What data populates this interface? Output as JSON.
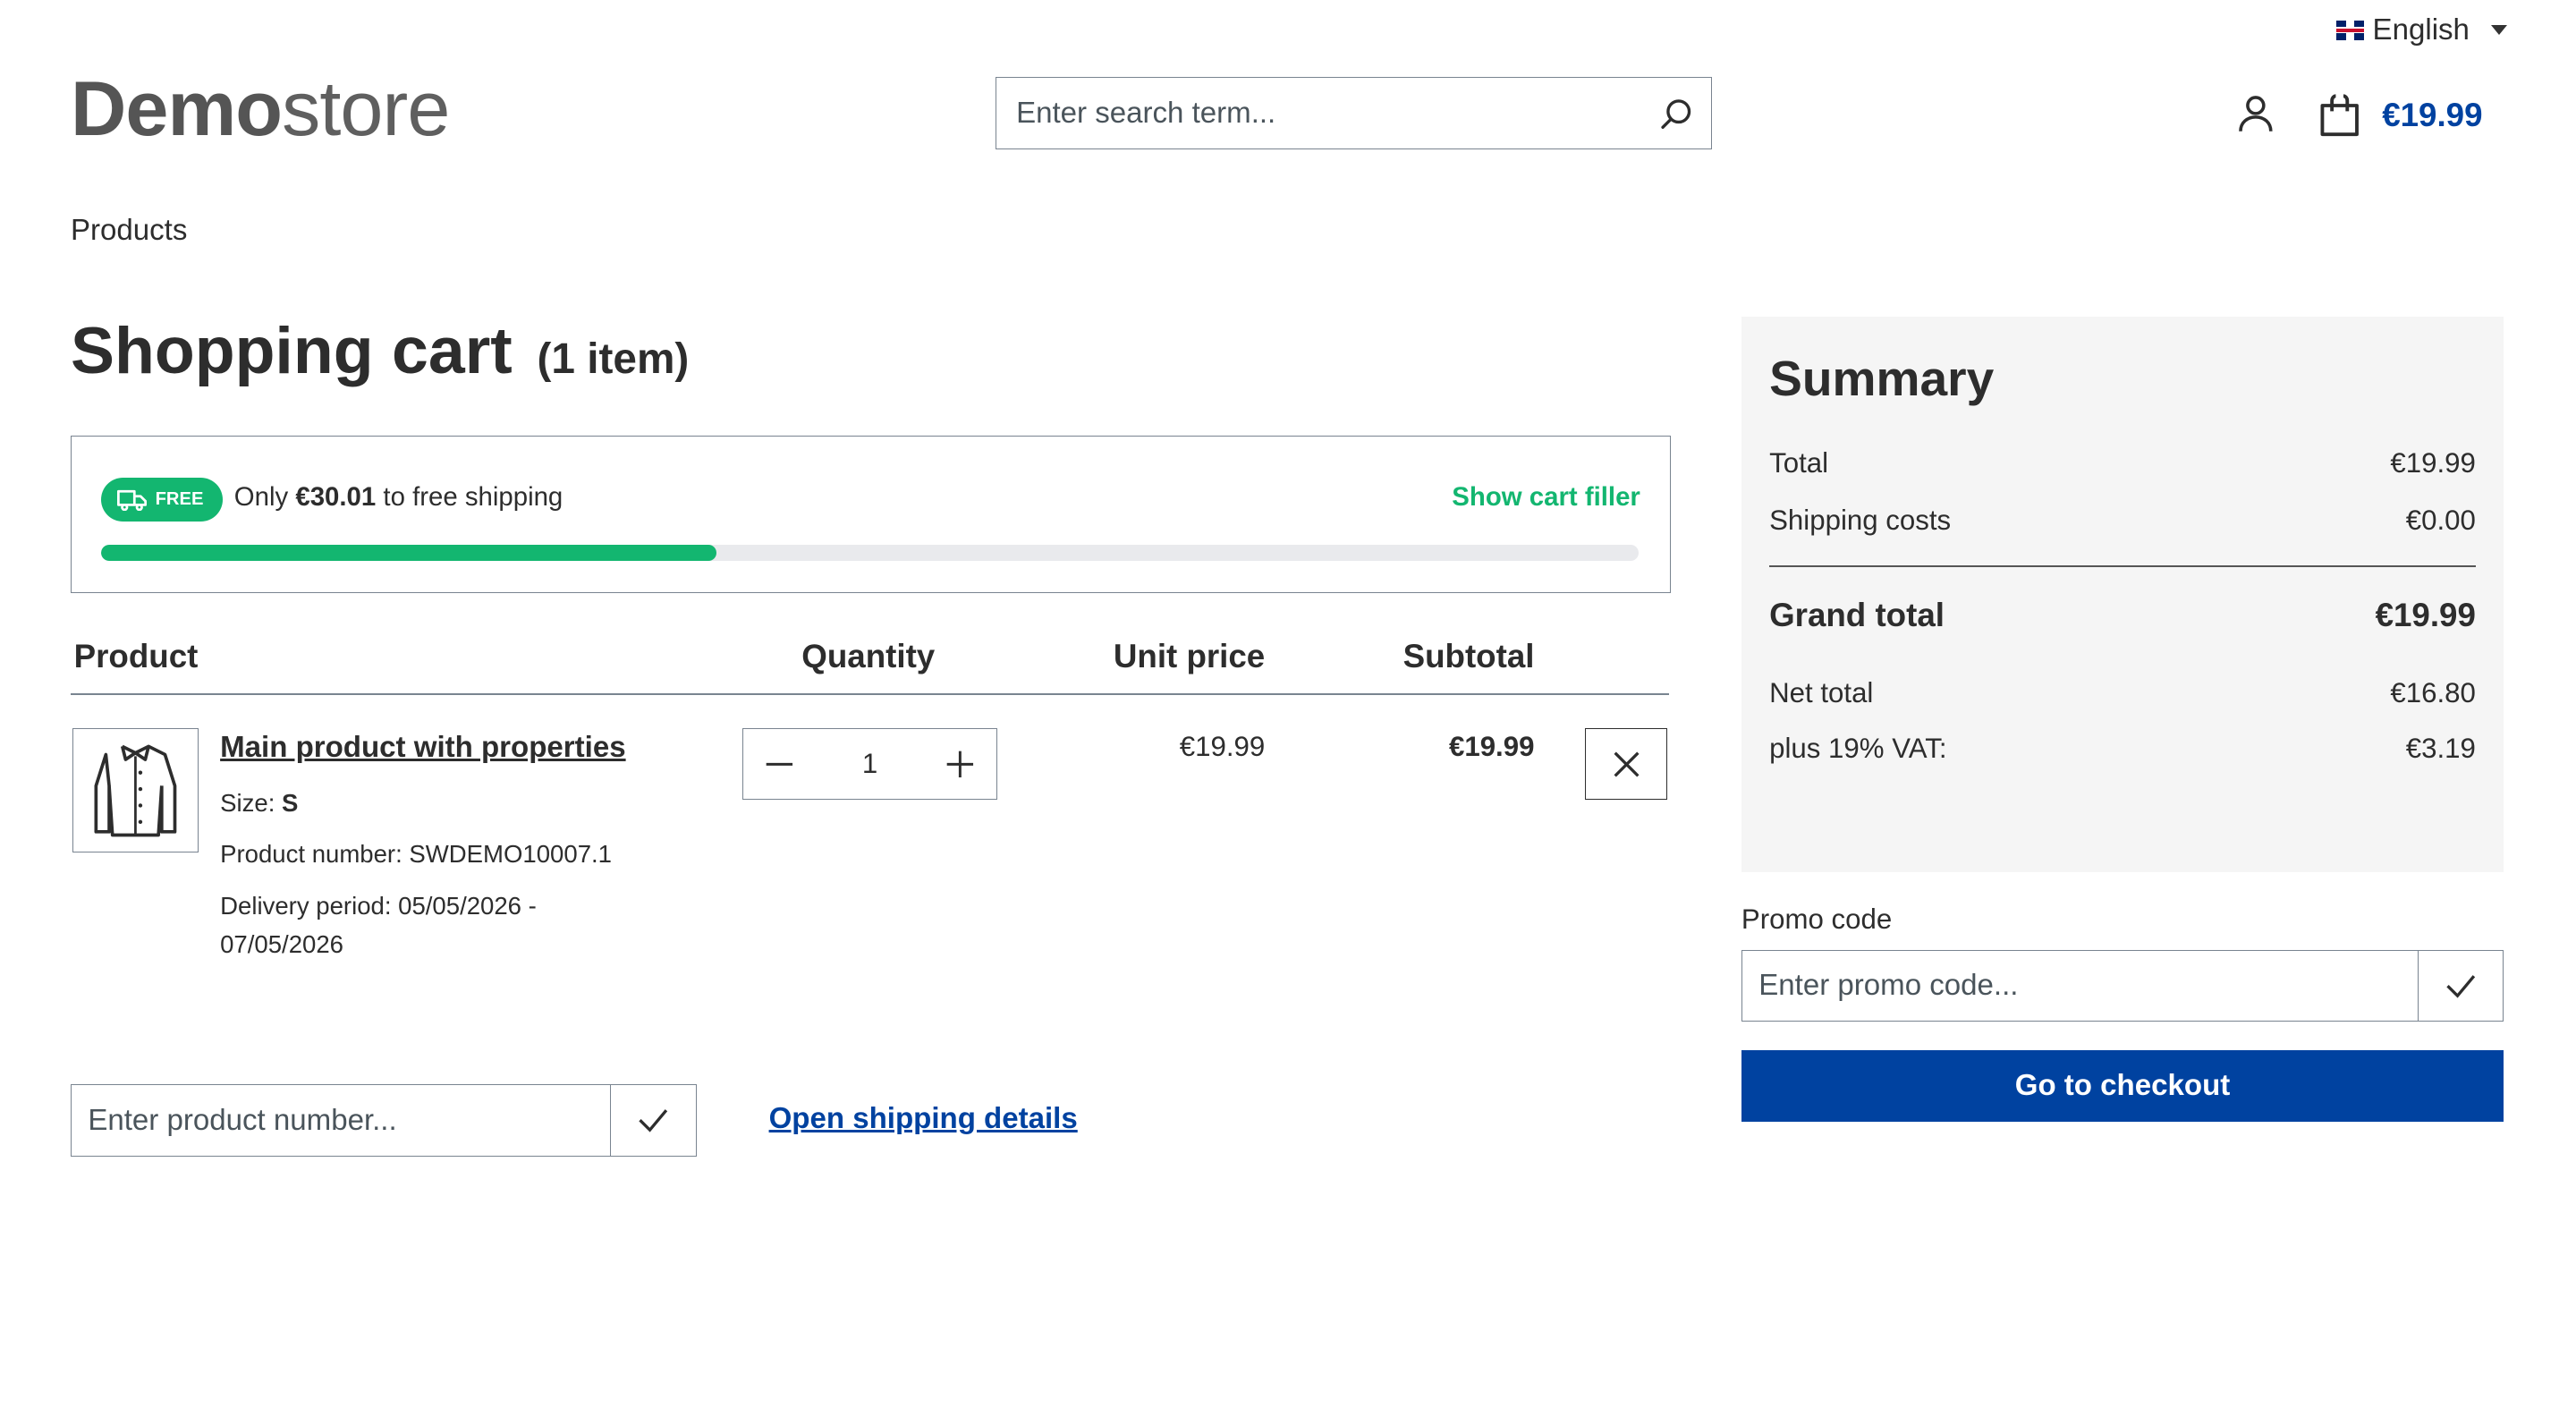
{
  "header": {
    "language": "English",
    "logo_bold": "Demo",
    "logo_light": "store",
    "search_placeholder": "Enter search term...",
    "cart_total": "€19.99"
  },
  "breadcrumb": "Products",
  "page": {
    "title": "Shopping cart",
    "item_count": "(1 item)"
  },
  "shipping": {
    "badge": "FREE",
    "prefix": "Only",
    "amount": "€30.01",
    "suffix": "to free shipping",
    "filler_link": "Show cart filler",
    "progress_fraction": 0.4
  },
  "table": {
    "headers": {
      "product": "Product",
      "quantity": "Quantity",
      "unit_price": "Unit price",
      "subtotal": "Subtotal"
    },
    "item": {
      "name": "Main product with properties",
      "size_label": "Size:",
      "size_value": "S",
      "product_number": "Product number: SWDEMO10007.1",
      "delivery_line1": "Delivery period: 05/05/2026 -",
      "delivery_line2": "07/05/2026",
      "quantity": "1",
      "unit_price": "€19.99",
      "subtotal": "€19.99",
      "image_icon": "jacket-icon"
    }
  },
  "add_product": {
    "placeholder": "Enter product number..."
  },
  "shipping_details_link": "Open shipping details",
  "summary": {
    "title": "Summary",
    "total_label": "Total",
    "total_value": "€19.99",
    "shipping_label": "Shipping costs",
    "shipping_value": "€0.00",
    "grand_label": "Grand total",
    "grand_value": "€19.99",
    "net_label": "Net total",
    "net_value": "€16.80",
    "vat_label": "plus 19% VAT:",
    "vat_value": "€3.19"
  },
  "promo": {
    "label": "Promo code",
    "placeholder": "Enter promo code..."
  },
  "checkout_label": "Go to checkout",
  "colors": {
    "accent": "#0042a0",
    "success": "#13b670"
  }
}
